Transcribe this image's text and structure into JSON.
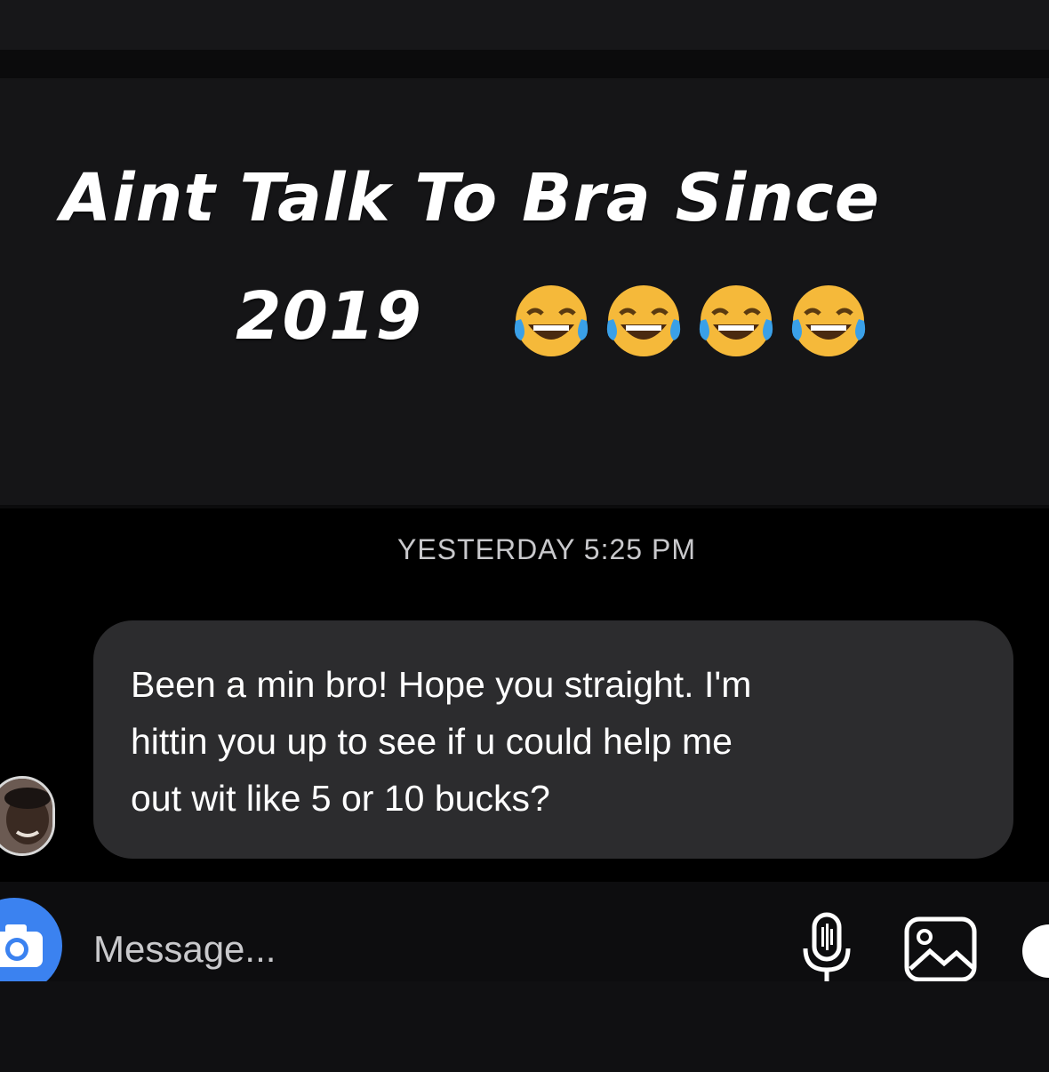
{
  "caption": {
    "line1": "Aint Talk To Bra Since",
    "line2": "2019",
    "emoji": [
      "face-with-tears-of-joy",
      "face-with-tears-of-joy",
      "face-with-tears-of-joy",
      "face-with-tears-of-joy"
    ]
  },
  "chat": {
    "timestamp": "YESTERDAY 5:25 PM",
    "message_lines": [
      "Been a min bro! Hope you straight. I'm",
      "hittin you up to see if u could help me",
      "out wit like 5 or 10 bucks?"
    ]
  },
  "composer": {
    "placeholder": "Message...",
    "icons": [
      "camera-icon",
      "microphone-icon",
      "image-icon",
      "sticker-icon"
    ]
  },
  "colors": {
    "bubble": "#2c2c2e",
    "camera_button": "#3b82f0",
    "background": "#000000"
  }
}
